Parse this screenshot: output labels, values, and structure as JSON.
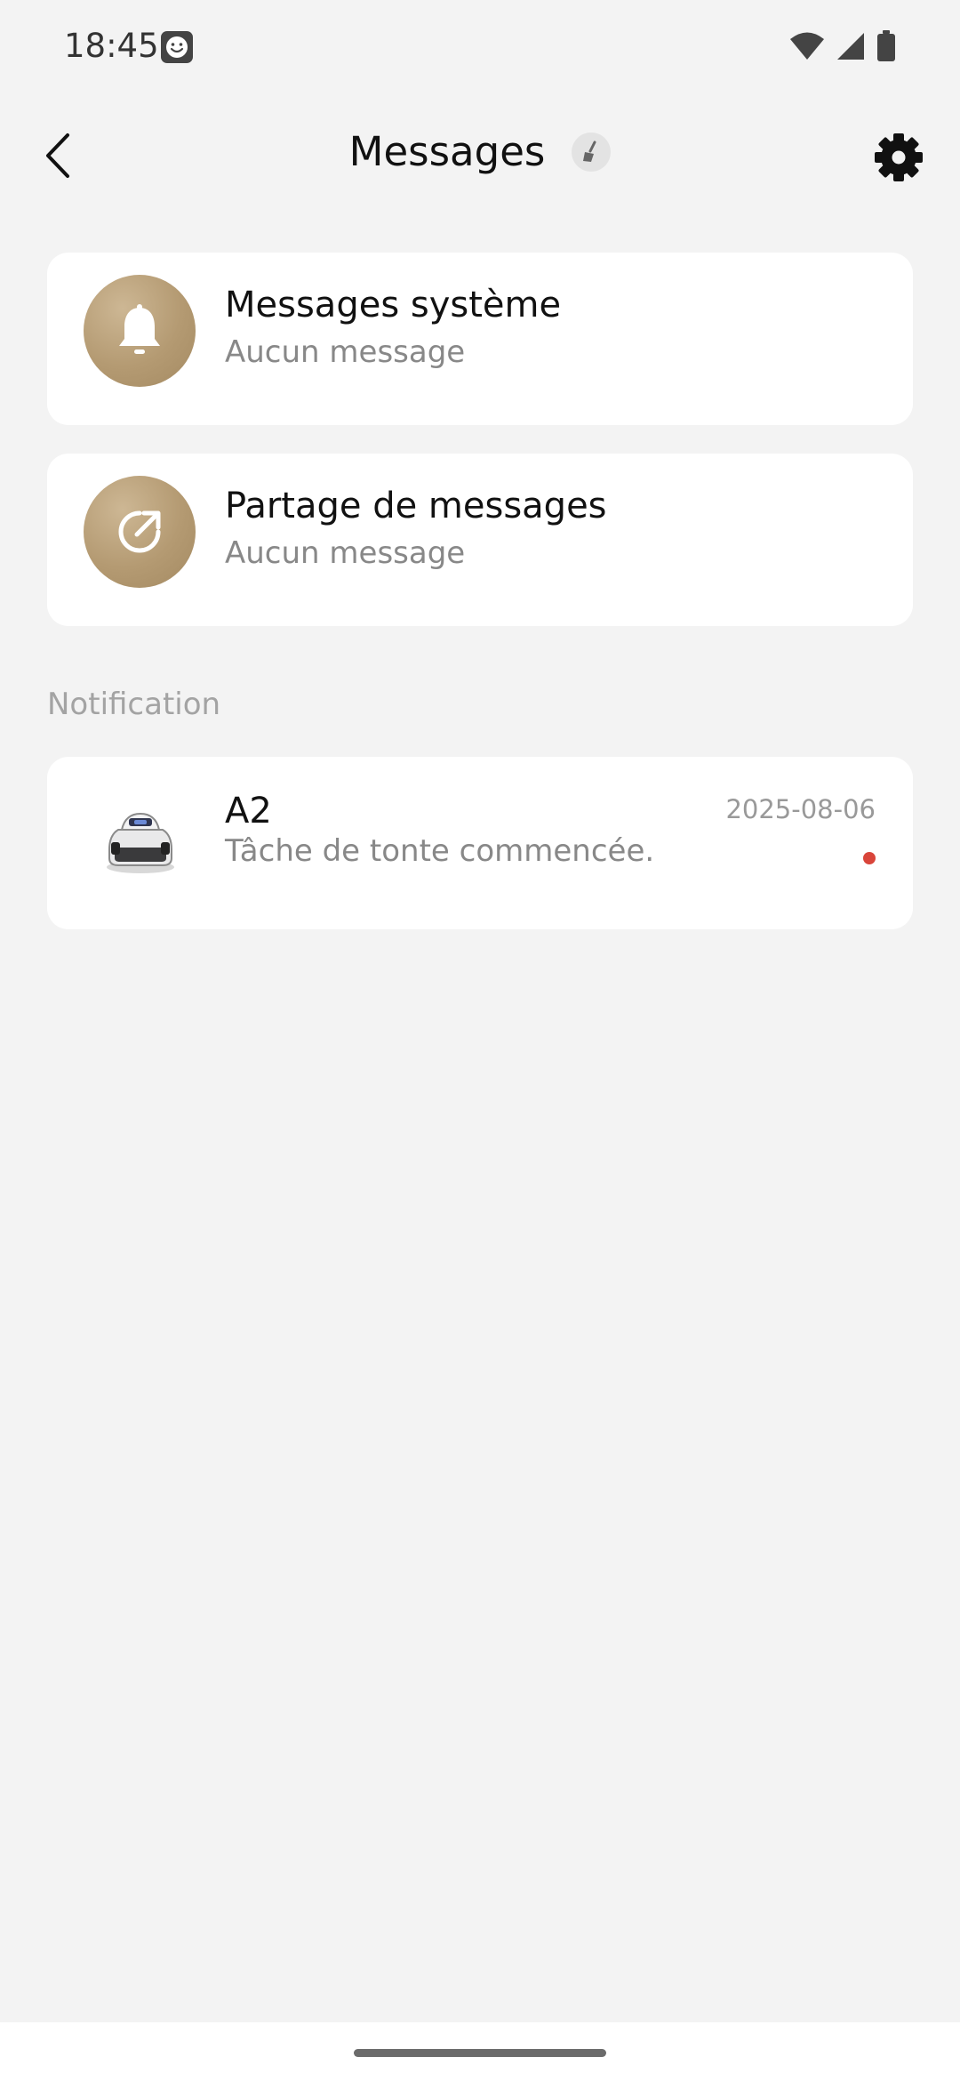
{
  "status_bar": {
    "time": "18:45",
    "icons": [
      "face-icon",
      "wifi-icon",
      "signal-icon",
      "battery-icon"
    ]
  },
  "header": {
    "title": "Messages",
    "back_icon": "chevron-left-icon",
    "clear_icon": "broom-icon",
    "settings_icon": "gear-icon"
  },
  "message_groups": [
    {
      "title": "Messages système",
      "subtitle": "Aucun message",
      "icon": "bell-icon"
    },
    {
      "title": "Partage de messages",
      "subtitle": "Aucun message",
      "icon": "share-icon"
    }
  ],
  "notification_section": {
    "label": "Notification",
    "items": [
      {
        "device": "A2",
        "message": "Tâche de tonte commencée.",
        "date": "2025-08-06",
        "unread": true,
        "icon": "robot-mower-icon"
      }
    ]
  },
  "colors": {
    "accent_gold": "#b49a72",
    "unread_red": "#d9453a",
    "background": "#f3f3f3"
  }
}
